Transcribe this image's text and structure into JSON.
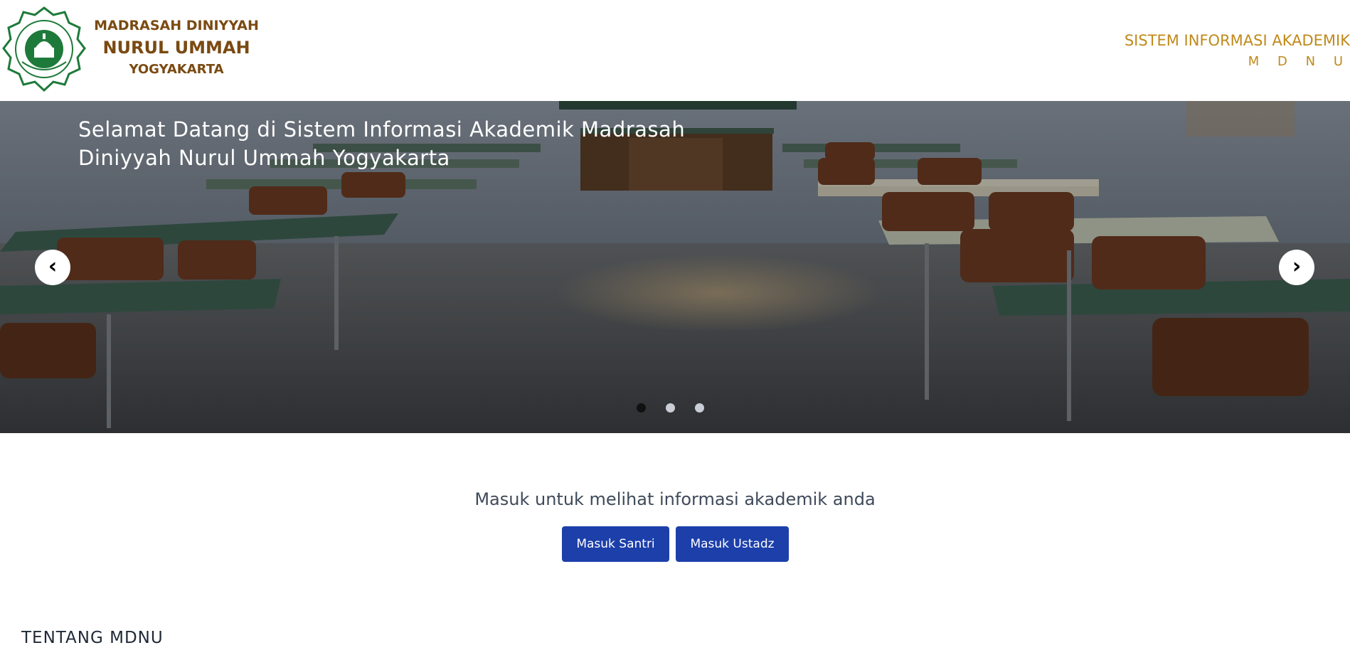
{
  "header": {
    "brand_line1": "MADRASAH DINIYYAH",
    "brand_line2": "NURUL UMMAH",
    "brand_line3": "YOGYAKARTA",
    "system_line1": "SISTEM INFORMASI AKADEMIK",
    "system_line2": "M D N U",
    "logo_icon": "madrasah-emblem-icon",
    "colors": {
      "brand": "#7a4a12",
      "system": "#c08a1b",
      "logo_green": "#1e7a3a"
    }
  },
  "hero": {
    "title": "Selamat Datang di Sistem Informasi Akademik Madrasah Diniyyah Nurul Ummah Yogyakarta",
    "prev_label": "‹",
    "next_label": "›",
    "slide_count": 3,
    "active_slide": 0
  },
  "login": {
    "prompt": "Masuk untuk melihat informasi akademik anda",
    "santri_label": "Masuk Santri",
    "ustadz_label": "Masuk Ustadz",
    "button_color": "#1c3faa"
  },
  "about": {
    "heading": "TENTANG MDNU"
  }
}
